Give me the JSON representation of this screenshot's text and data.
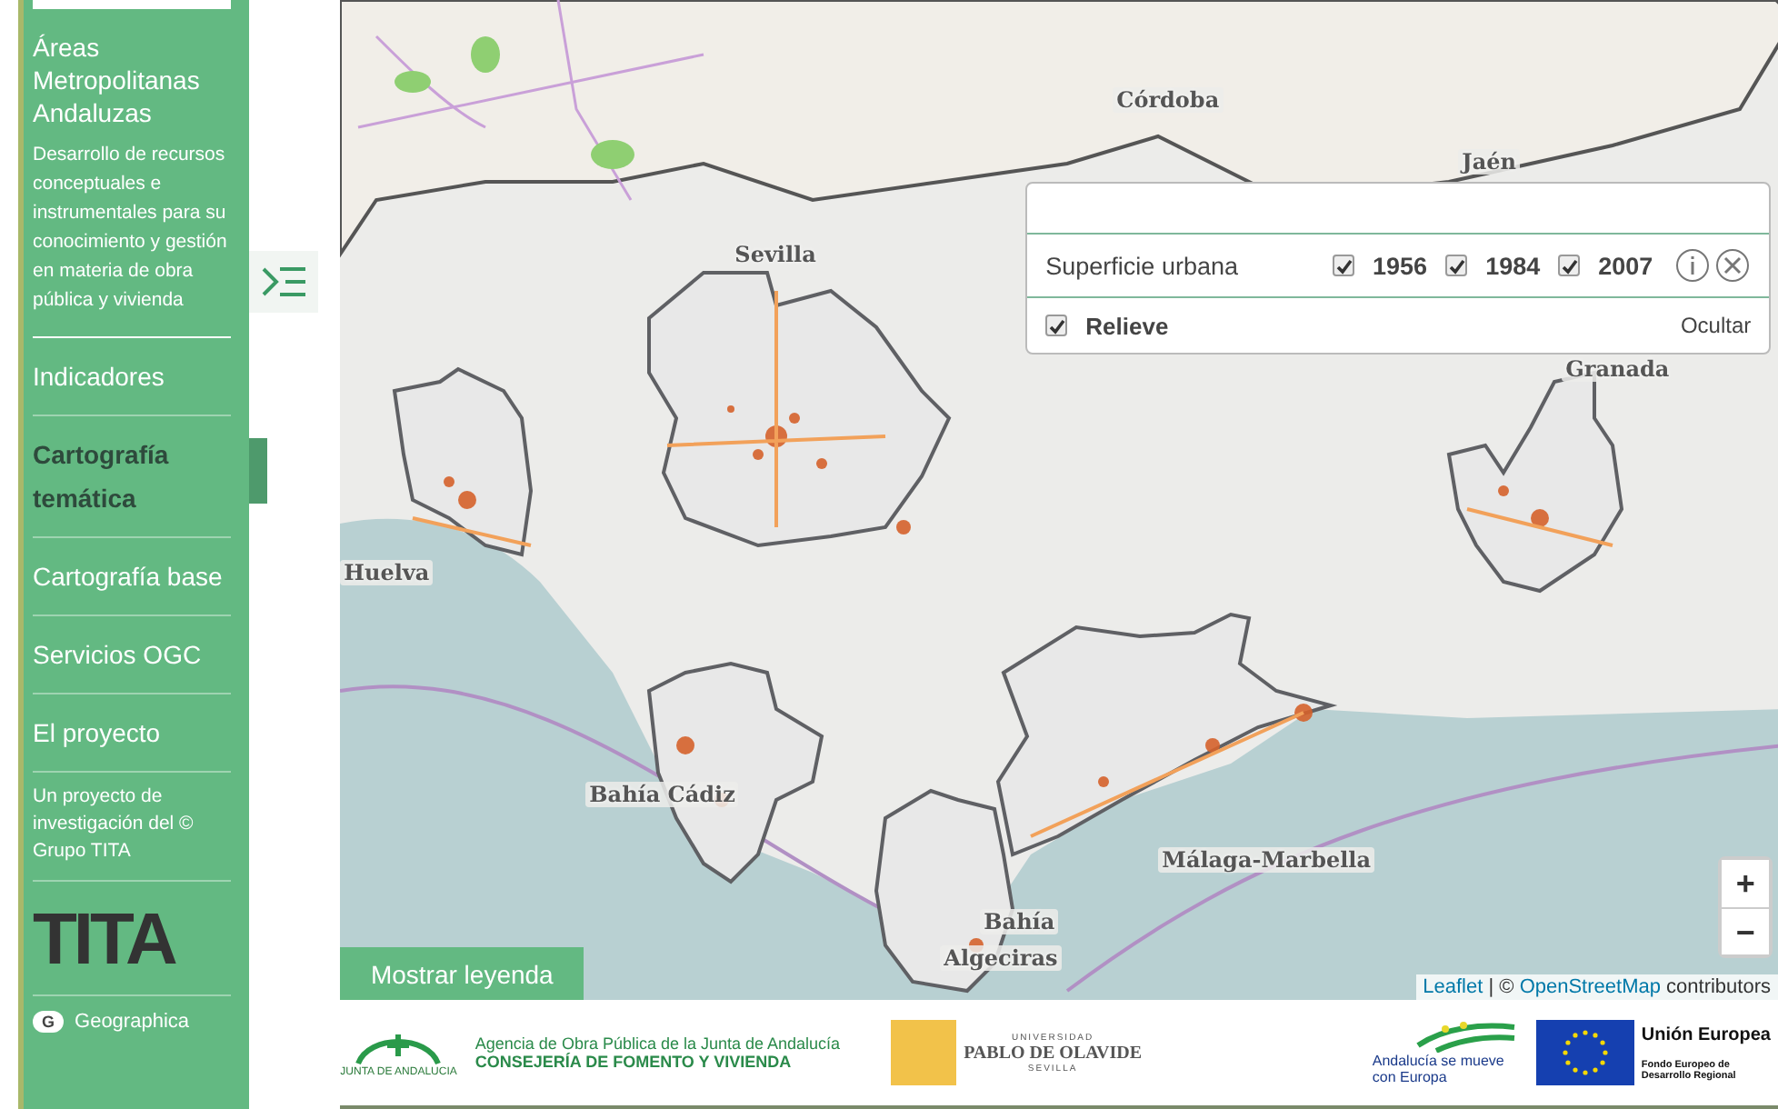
{
  "sidebar": {
    "title": "Áreas Metropolitanas Andaluzas",
    "description": "Desarrollo de recursos conceptuales e instrumentales para su conocimiento y gestión en materia de obra pública y vivienda",
    "nav": [
      {
        "label": "Indicadores",
        "selected": false
      },
      {
        "label": "Cartografía temática",
        "selected": true
      },
      {
        "label": "Cartografía base",
        "selected": false
      },
      {
        "label": "Servicios OGC",
        "selected": false
      },
      {
        "label": "El proyecto",
        "selected": false
      }
    ],
    "credit": "Un proyecto de investigación del © Grupo TITA",
    "logo": "TITA",
    "badge": "G",
    "brand": "Geographica"
  },
  "map": {
    "labels": [
      "Córdoba",
      "Jaén",
      "Sevilla",
      "Granada",
      "Huelva",
      "Bahía Cádiz",
      "Málaga-Marbella",
      "Bahía",
      "Algeciras"
    ],
    "panel": {
      "layer": "Superficie urbana",
      "years": [
        {
          "label": "1956",
          "checked": true
        },
        {
          "label": "1984",
          "checked": true
        },
        {
          "label": "2007",
          "checked": true
        }
      ],
      "relief": {
        "label": "Relieve",
        "checked": true
      },
      "hide": "Ocultar"
    },
    "zoom_in": "+",
    "zoom_out": "−",
    "legend_button": "Mostrar leyenda",
    "attribution": {
      "leaflet": "Leaflet",
      "separator": "| ©",
      "osm": "OpenStreetMap",
      "suffix": "contributors"
    }
  },
  "footer": {
    "junta": "JUNTA DE ANDALUCIA",
    "agency": "Agencia de Obra Pública de la Junta de Andalucía",
    "ministry": "CONSEJERÍA DE FOMENTO Y VIVIENDA",
    "upo_top": "UNIVERSIDAD",
    "upo_name": "PABLO DE OLAVIDE",
    "upo_city": "SEVILLA",
    "andalucia": "Andalucía se mueve con Europa",
    "eu": "Unión Europea",
    "feder": "Fondo Europeo de Desarrollo Regional"
  }
}
